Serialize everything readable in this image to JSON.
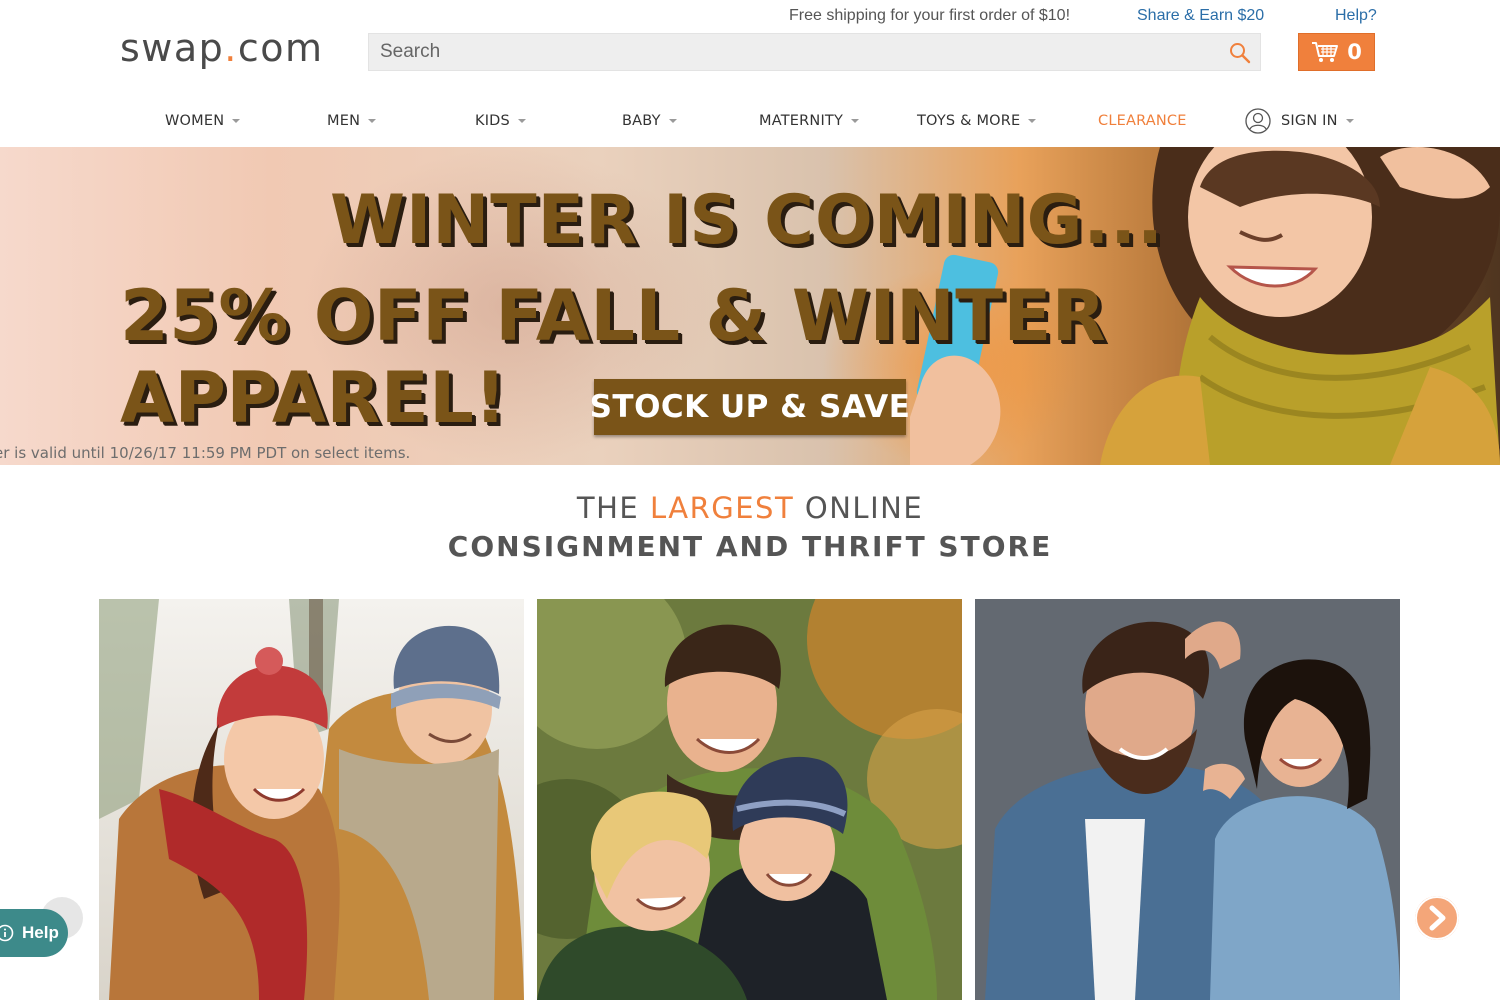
{
  "header": {
    "promo_text": "Free shipping for your first order of $10!",
    "share_link": "Share & Earn $20",
    "help_link": "Help?",
    "logo": {
      "part1": "swap",
      "dot": ".",
      "part2": "com"
    },
    "search": {
      "placeholder": "Search",
      "value": ""
    },
    "cart": {
      "count": "0"
    },
    "colors": {
      "accent": "#f0803c",
      "link": "#2b6ea8"
    }
  },
  "nav": {
    "items": [
      {
        "label": "WOMEN",
        "has_dropdown": true
      },
      {
        "label": "MEN",
        "has_dropdown": true
      },
      {
        "label": "KIDS",
        "has_dropdown": true
      },
      {
        "label": "BABY",
        "has_dropdown": true
      },
      {
        "label": "MATERNITY",
        "has_dropdown": true
      },
      {
        "label": "TOYS & MORE",
        "has_dropdown": true
      },
      {
        "label": "CLEARANCE",
        "has_dropdown": false
      },
      {
        "label": "SIGN IN",
        "has_dropdown": true
      }
    ]
  },
  "hero": {
    "line1": "WINTER IS COMING...",
    "line2": "25% OFF FALL & WINTER APPAREL!",
    "cta": "STOCK UP & SAVE",
    "disclaimer": "er is valid until 10/26/17 11:59 PM PDT on select items."
  },
  "tagline": {
    "word1": "THE",
    "accent": "LARGEST",
    "word3": "ONLINE",
    "line2": "CONSIGNMENT AND THRIFT STORE"
  },
  "help_widget": {
    "label": "Help"
  }
}
